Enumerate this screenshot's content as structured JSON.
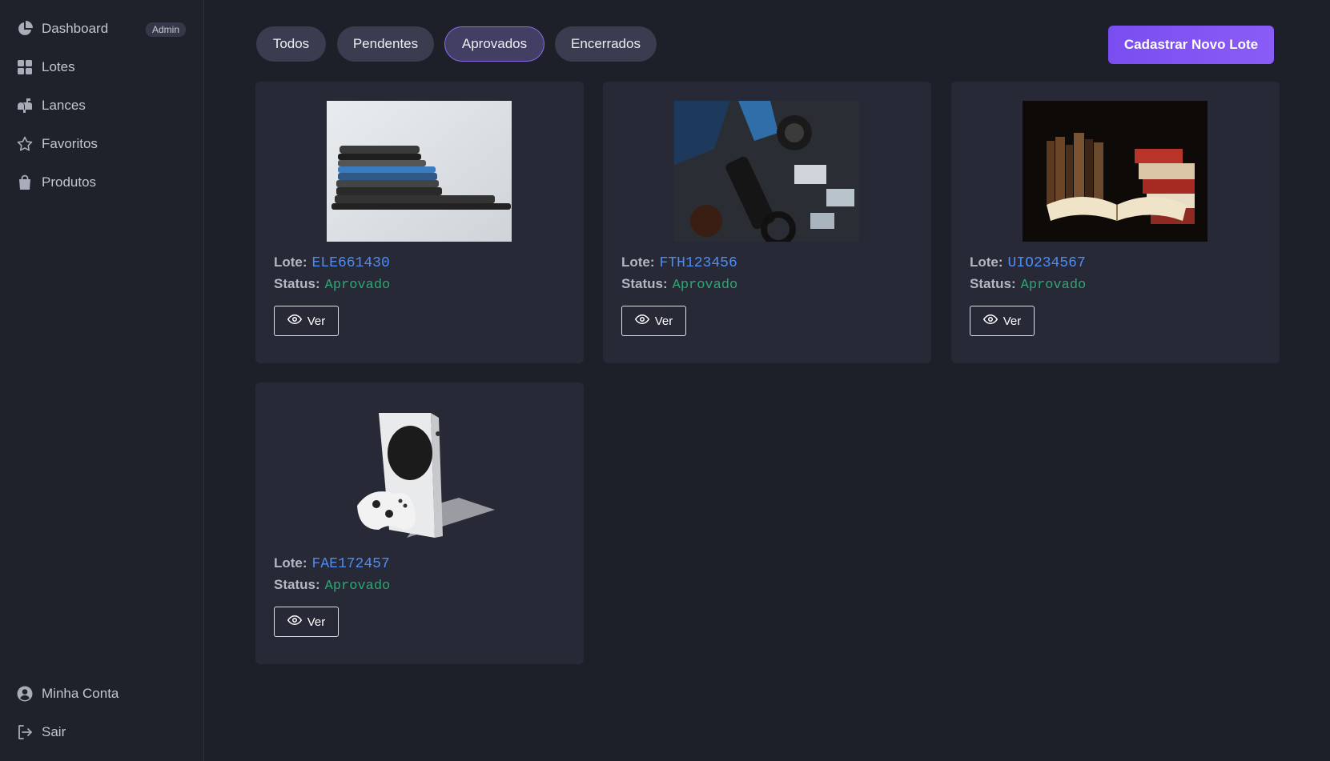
{
  "sidebar": {
    "items": [
      {
        "label": "Dashboard",
        "icon": "pie-chart-icon"
      },
      {
        "label": "Lotes",
        "icon": "grid-icon"
      },
      {
        "label": "Lances",
        "icon": "mailbox-icon"
      },
      {
        "label": "Favoritos",
        "icon": "star-icon"
      },
      {
        "label": "Produtos",
        "icon": "shopping-bag-icon"
      }
    ],
    "badge": "Admin",
    "footer": [
      {
        "label": "Minha Conta",
        "icon": "user-circle-icon"
      },
      {
        "label": "Sair",
        "icon": "logout-icon"
      }
    ]
  },
  "filters": {
    "tabs": [
      "Todos",
      "Pendentes",
      "Aprovados",
      "Encerrados"
    ],
    "active": "Aprovados"
  },
  "actions": {
    "new_lot": "Cadastrar Novo Lote"
  },
  "cards": [
    {
      "lote_label": "Lote:",
      "lote": "ELE661430",
      "status_label": "Status:",
      "status": "Aprovado",
      "button": "Ver",
      "image": "stacked-phones-image"
    },
    {
      "lote_label": "Lote:",
      "lote": "FTH123456",
      "status_label": "Status:",
      "status": "Aprovado",
      "button": "Ver",
      "image": "camera-gear-image"
    },
    {
      "lote_label": "Lote:",
      "lote": "UIO234567",
      "status_label": "Status:",
      "status": "Aprovado",
      "button": "Ver",
      "image": "old-books-image"
    },
    {
      "lote_label": "Lote:",
      "lote": "FAE172457",
      "status_label": "Status:",
      "status": "Aprovado",
      "button": "Ver",
      "image": "game-console-image"
    }
  ],
  "colors": {
    "background": "#1d1f29",
    "card": "#272936",
    "accent": "#8b5cf6",
    "lote": "#4d8cf5",
    "status": "#2fa572"
  }
}
